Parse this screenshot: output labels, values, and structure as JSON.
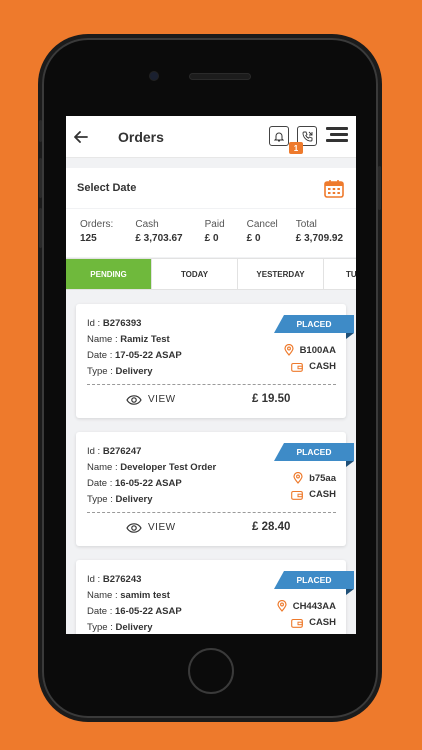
{
  "header": {
    "title": "Orders",
    "notification_count": "1"
  },
  "date_filter": {
    "label": "Select Date"
  },
  "stats": [
    {
      "label": "Orders:",
      "value": "125"
    },
    {
      "label": "Cash",
      "value": "£ 3,703.67"
    },
    {
      "label": "Paid",
      "value": "£ 0"
    },
    {
      "label": "Cancel",
      "value": "£ 0"
    },
    {
      "label": "Total",
      "value": "£ 3,709.92"
    }
  ],
  "tabs": [
    {
      "label": "PENDING",
      "active": true
    },
    {
      "label": "TODAY"
    },
    {
      "label": "YESTERDAY"
    },
    {
      "label": "TU"
    }
  ],
  "labels": {
    "id": "Id : ",
    "name": "Name : ",
    "date": "Date : ",
    "type": "Type : ",
    "view": "VIEW"
  },
  "orders": [
    {
      "id": "B276393",
      "name": "Ramiz Test",
      "date": "17-05-22 ASAP",
      "type": "Delivery",
      "status": "PLACED",
      "postcode": "B100AA",
      "payment": "CASH",
      "amount": "£ 19.50"
    },
    {
      "id": "B276247",
      "name": "Developer Test Order",
      "date": "16-05-22 ASAP",
      "type": "Delivery",
      "status": "PLACED",
      "postcode": "b75aa",
      "payment": "CASH",
      "amount": "£ 28.40"
    },
    {
      "id": "B276243",
      "name": "samim test",
      "date": "16-05-22 ASAP",
      "type": "Delivery",
      "status": "PLACED",
      "postcode": "CH443AA",
      "payment": "CASH",
      "amount": ""
    }
  ],
  "colors": {
    "brand": "#EE7A2C",
    "active_tab": "#6FB93C",
    "status_ribbon": "#3E8BC7"
  }
}
